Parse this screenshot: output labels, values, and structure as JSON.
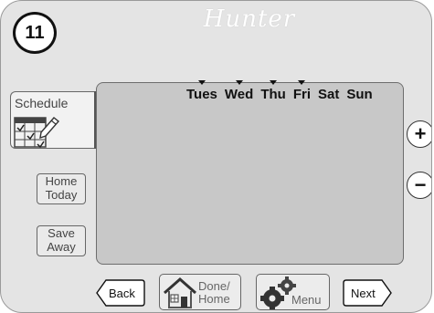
{
  "step": {
    "number": "11"
  },
  "brand": {
    "name": "Hunter"
  },
  "days": [
    "Tues",
    "Wed",
    "Thu",
    "Fri",
    "Sat",
    "Sun"
  ],
  "days_marked": [
    true,
    true,
    true,
    true,
    false,
    false
  ],
  "side_buttons": {
    "schedule": "Schedule",
    "home_today_line1": "Home",
    "home_today_line2": "Today",
    "save_away_line1": "Save",
    "save_away_line2": "Away"
  },
  "right_buttons": {
    "plus": "+",
    "minus": "−"
  },
  "bottom_buttons": {
    "back": "Back",
    "done_line1": "Done/",
    "done_line2": "Home",
    "menu": "Menu",
    "next": "Next"
  },
  "icons": {
    "schedule": "calendar-pencil-icon",
    "done": "house-icon",
    "menu": "gears-icon"
  }
}
